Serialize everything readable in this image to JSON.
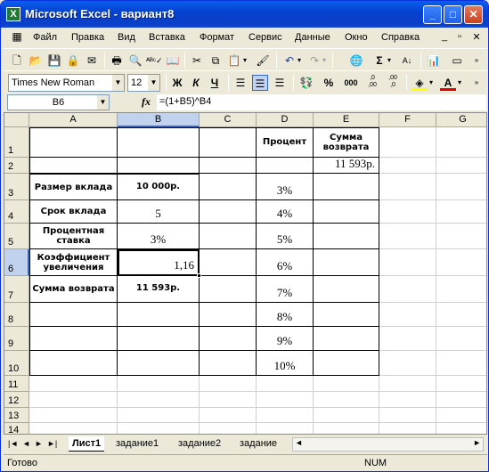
{
  "window": {
    "title": "Microsoft Excel - вариант8",
    "app_icon": "X",
    "btn_min": "_",
    "btn_max": "□",
    "btn_close": "✕"
  },
  "menu": [
    "Файл",
    "Правка",
    "Вид",
    "Вставка",
    "Формат",
    "Сервис",
    "Данные",
    "Окно",
    "Справка"
  ],
  "mdi": {
    "min": "_",
    "restore": "▫",
    "close": "✕"
  },
  "format": {
    "font": "Times New Roman",
    "size": "12",
    "bold": "Ж",
    "italic": "К",
    "underline": "Ч",
    "percent": "%",
    "thousands": "000",
    "inc_dec": ",0\n,00",
    "dec_dec": ",00\n,0"
  },
  "formula_bar": {
    "name_box": "B6",
    "fx": "fx",
    "formula": "=(1+B5)^B4"
  },
  "columns": [
    "A",
    "B",
    "C",
    "D",
    "E",
    "F",
    "G"
  ],
  "rows": [
    "1",
    "2",
    "3",
    "4",
    "5",
    "6",
    "7",
    "8",
    "9",
    "10",
    "11",
    "12",
    "13",
    "14"
  ],
  "cells": {
    "D1": "Процент",
    "E1": "Сумма возврата",
    "E2": "11 593р.",
    "A3": "Размер вклада",
    "B3": "10 000р.",
    "D3": "3%",
    "A4": "Срок вклада",
    "B4": "5",
    "D4": "4%",
    "A5": "Процентная ставка",
    "B5": "3%",
    "D5": "5%",
    "A6": "Коэффициент увеличения",
    "B6": "1,16",
    "D6": "6%",
    "A7": "Сумма возврата",
    "B7": "11 593р.",
    "D7": "7%",
    "D8": "8%",
    "D9": "9%",
    "D10": "10%"
  },
  "sheets": [
    "Лист1",
    "задание1",
    "задание2",
    "задание"
  ],
  "status": {
    "ready": "Готово",
    "num": "NUM"
  },
  "colors": {
    "title_bar": "#0A5FEF",
    "selection": "#C1D2EE",
    "chrome": "#ECE9D8"
  }
}
